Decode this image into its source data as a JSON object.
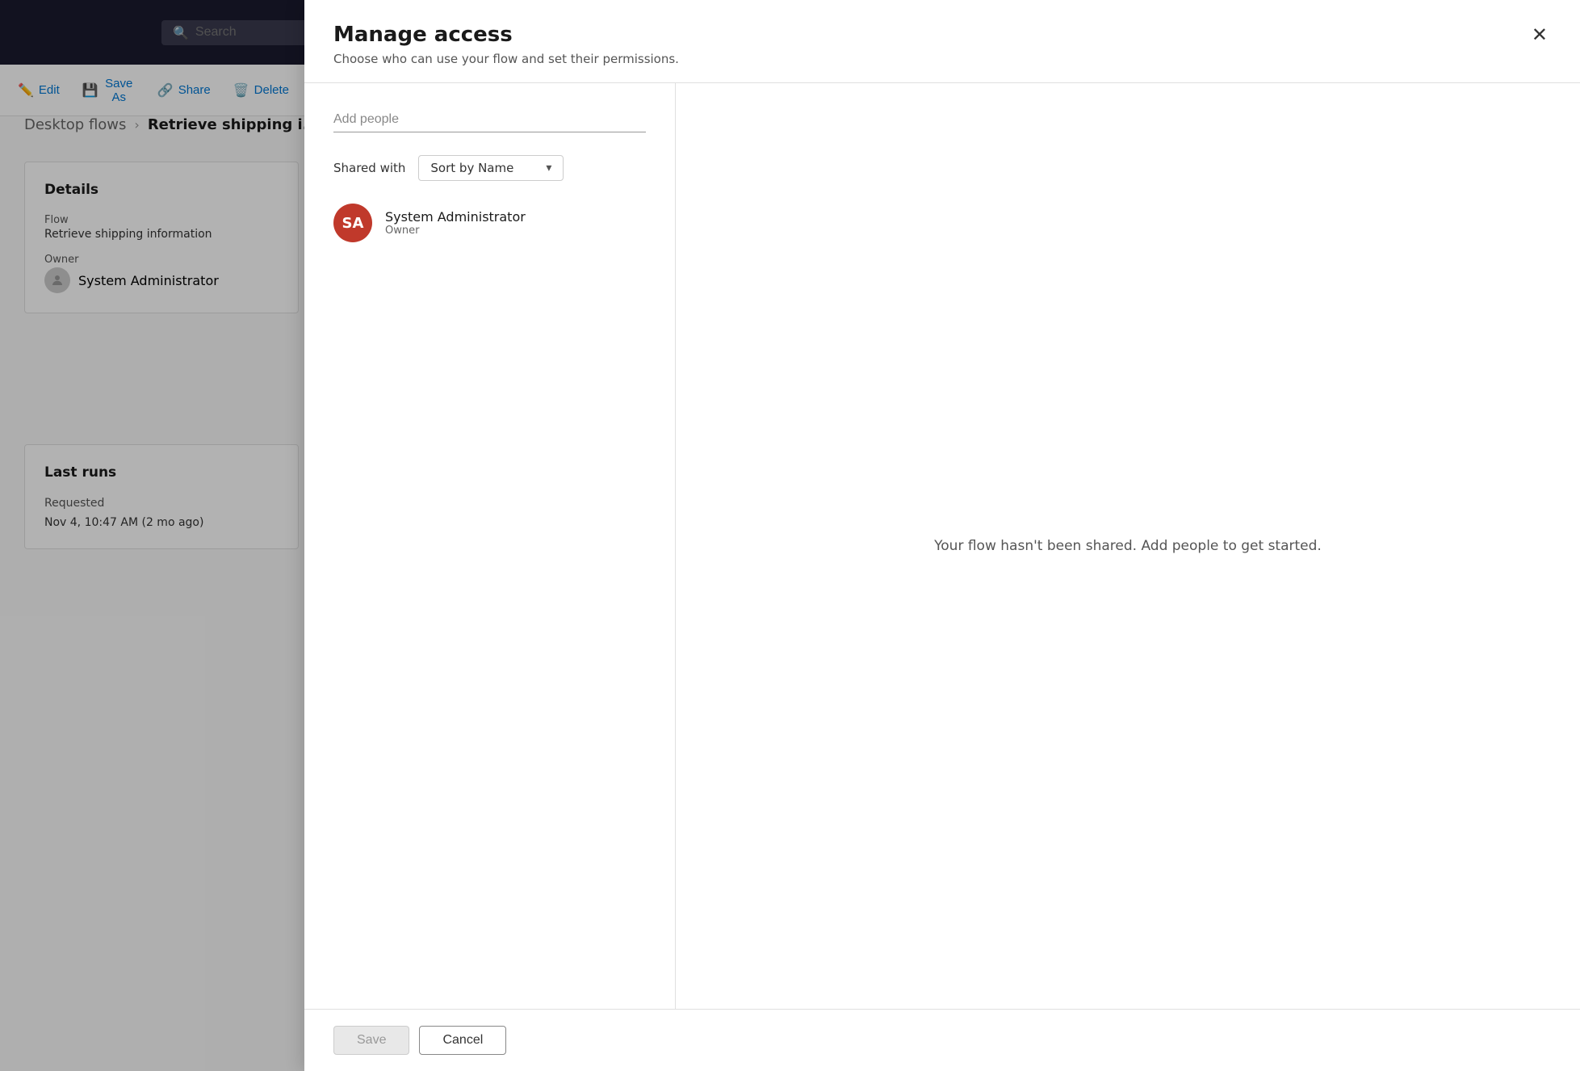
{
  "topbar": {
    "search_placeholder": "Search"
  },
  "toolbar": {
    "edit_label": "Edit",
    "save_as_label": "Save As",
    "share_label": "Share",
    "delete_label": "Delete"
  },
  "breadcrumb": {
    "parent": "Desktop flows",
    "current": "Retrieve shipping i..."
  },
  "details_card": {
    "title": "Details",
    "flow_label": "Flow",
    "flow_value": "Retrieve shipping information",
    "owner_label": "Owner",
    "owner_value": "System Administrator"
  },
  "runs_card": {
    "title": "Last runs",
    "requested_label": "Requested",
    "run_date": "Nov 4, 10:47 AM (2 mo ago)"
  },
  "modal": {
    "title": "Manage access",
    "subtitle": "Choose who can use your flow and set their permissions.",
    "add_people_placeholder": "Add people",
    "shared_with_label": "Shared with",
    "sort_label": "Sort by Name",
    "users": [
      {
        "initials": "SA",
        "name": "System Administrator",
        "role": "Owner"
      }
    ],
    "empty_state": "Your flow hasn't been shared. Add people to get started.",
    "save_label": "Save",
    "cancel_label": "Cancel"
  }
}
